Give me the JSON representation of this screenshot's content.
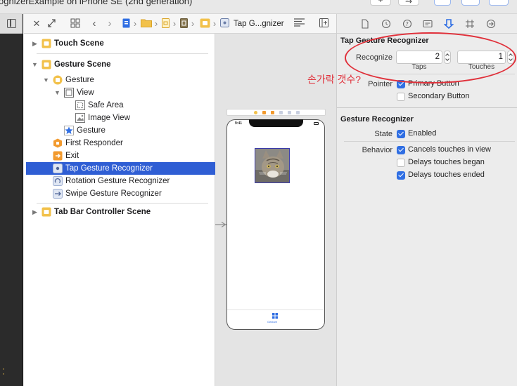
{
  "window": {
    "title": "ognizerExample on iPhone SE (2nd generation)"
  },
  "jumpbar": {
    "last_item": "Tap G...gnizer"
  },
  "outline": {
    "items": [
      {
        "label": "Touch Scene",
        "kind": "scene",
        "expanded": false
      },
      {
        "label": "Gesture Scene",
        "kind": "scene",
        "expanded": true
      },
      {
        "label": "Gesture",
        "kind": "view-controller",
        "expanded": true
      },
      {
        "label": "View",
        "kind": "view",
        "expanded": true
      },
      {
        "label": "Safe Area",
        "kind": "safe-area"
      },
      {
        "label": "Image View",
        "kind": "image-view"
      },
      {
        "label": "Gesture",
        "kind": "tab-bar-item"
      },
      {
        "label": "First Responder",
        "kind": "first-responder"
      },
      {
        "label": "Exit",
        "kind": "exit"
      },
      {
        "label": "Tap Gesture Recognizer",
        "kind": "gesture",
        "selected": true
      },
      {
        "label": "Rotation Gesture Recognizer",
        "kind": "gesture"
      },
      {
        "label": "Swipe Gesture Recognizer",
        "kind": "gesture"
      },
      {
        "label": "Tab Bar Controller Scene",
        "kind": "scene",
        "expanded": false
      }
    ]
  },
  "canvas": {
    "status_time": "9:41",
    "tab_label": "Gesture"
  },
  "inspector": {
    "section1_title": "Tap Gesture Recognizer",
    "recognize_label": "Recognize",
    "taps_value": "2",
    "taps_label": "Taps",
    "touches_value": "1",
    "touches_label": "Touches",
    "pointer_label": "Pointer",
    "primary_button": {
      "label": "Primary Button",
      "checked": true
    },
    "secondary_button": {
      "label": "Secondary Button",
      "checked": false
    },
    "section2_title": "Gesture Recognizer",
    "state_label": "State",
    "enabled": {
      "label": "Enabled",
      "checked": true
    },
    "behavior_label": "Behavior",
    "cancels_touches": {
      "label": "Cancels touches in view",
      "checked": true
    },
    "delays_began": {
      "label": "Delays touches began",
      "checked": false
    },
    "delays_ended": {
      "label": "Delays touches ended",
      "checked": true
    }
  },
  "annotation": {
    "text": "손가락 갯수?",
    "color": "#e0303a"
  },
  "colors": {
    "selection": "#2f5ed4",
    "accent": "#2f6ee3",
    "scene_icon": "#f2c14a"
  }
}
